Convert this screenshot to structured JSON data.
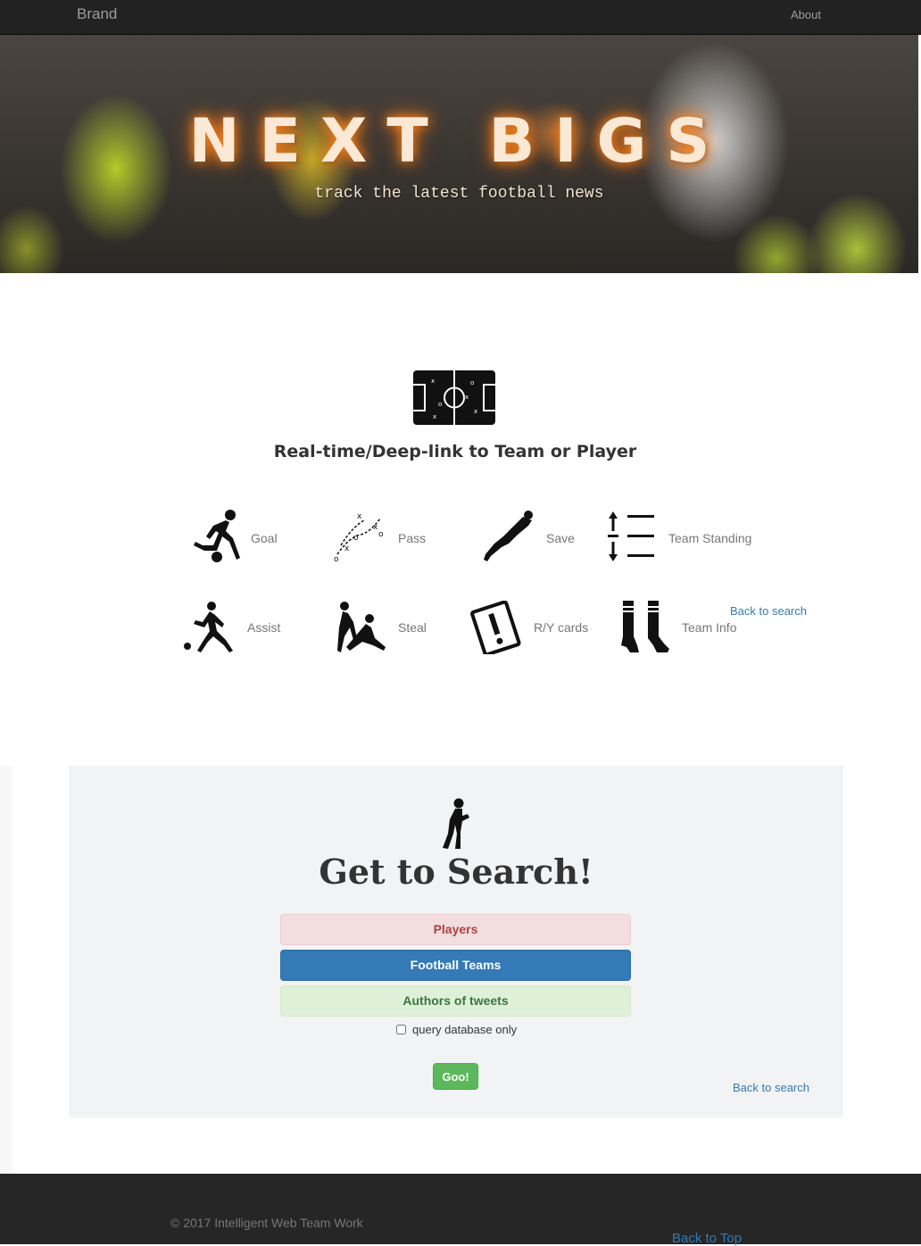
{
  "navbar": {
    "brand": "Brand",
    "about": "About"
  },
  "hero": {
    "title": "NEXT BIGS",
    "subtitle": "track the latest football news"
  },
  "features": {
    "heading": "Real-time/Deep-link to Team or Player",
    "items": [
      {
        "label": "Goal",
        "icon": "kick-ball-icon"
      },
      {
        "label": "Pass",
        "icon": "tactics-pass-icon"
      },
      {
        "label": "Save",
        "icon": "goalkeeper-dive-icon"
      },
      {
        "label": "Team Standing",
        "icon": "ranking-list-icon"
      },
      {
        "label": "Assist",
        "icon": "assist-player-icon"
      },
      {
        "label": "Steal",
        "icon": "tackle-icon"
      },
      {
        "label": "R/Y cards",
        "icon": "warning-card-icon"
      },
      {
        "label": "Team Info",
        "icon": "socks-icon"
      }
    ],
    "back_link": "Back to search"
  },
  "search": {
    "title": "Get to Search!",
    "options": {
      "players": "Players",
      "teams": "Football Teams",
      "authors": "Authors of tweets"
    },
    "checkbox_label": "query database only",
    "submit": "Goo!",
    "back_link": "Back to search",
    "colors": {
      "players": "#f2dede",
      "teams": "#337ab7",
      "authors": "#dff0d8",
      "submit": "#5cb85c"
    }
  },
  "footer": {
    "copyright": "© 2017 Intelligent Web Team Work",
    "back_to_top": "Back to Top"
  }
}
